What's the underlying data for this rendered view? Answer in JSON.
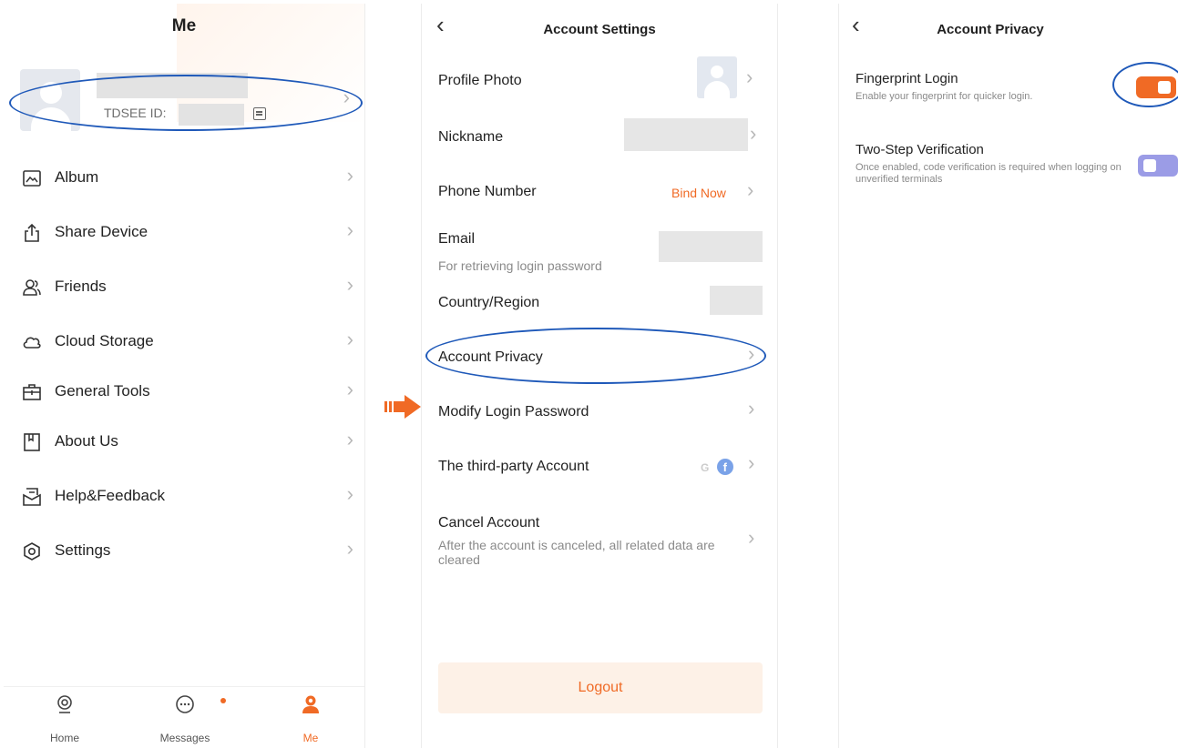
{
  "screen_me": {
    "title": "Me",
    "profile": {
      "id_label": "TDSEE  ID:"
    },
    "menu": [
      {
        "label": "Album",
        "icon": "album-icon"
      },
      {
        "label": "Share Device",
        "icon": "share-icon"
      },
      {
        "label": "Friends",
        "icon": "friends-icon"
      },
      {
        "label": "Cloud Storage",
        "icon": "cloud-icon"
      },
      {
        "label": "General Tools",
        "icon": "toolbox-icon"
      },
      {
        "label": "About Us",
        "icon": "bookmark-icon"
      },
      {
        "label": "Help&Feedback",
        "icon": "feedback-icon"
      },
      {
        "label": "Settings",
        "icon": "settings-icon"
      }
    ],
    "tabs": [
      {
        "label": "Home"
      },
      {
        "label": "Messages"
      },
      {
        "label": "Me"
      }
    ]
  },
  "screen_account_settings": {
    "title": "Account Settings",
    "rows": {
      "profile_photo": "Profile Photo",
      "nickname": "Nickname",
      "phone_number": "Phone Number",
      "bind_now": "Bind Now",
      "email": "Email",
      "email_sub": "For retrieving login password",
      "country_region": "Country/Region",
      "account_privacy": "Account Privacy",
      "modify_password": "Modify Login Password",
      "third_party": "The third-party Account",
      "third_party_g": "G",
      "third_party_fb": "f",
      "cancel_account": "Cancel Account",
      "cancel_sub": "After the account is canceled, all related data are cleared"
    },
    "logout": "Logout"
  },
  "screen_account_privacy": {
    "title": "Account Privacy",
    "fingerprint": {
      "label": "Fingerprint Login",
      "sub": "Enable your fingerprint for quicker login.",
      "enabled": true
    },
    "two_step": {
      "label": "Two-Step Verification",
      "sub": "Once enabled, code verification is required when logging on unverified terminals",
      "enabled": false
    }
  },
  "colors": {
    "accent": "#f06a25",
    "highlight_ellipse": "#1f59b9",
    "toggle_off": "#9b9ce6"
  }
}
